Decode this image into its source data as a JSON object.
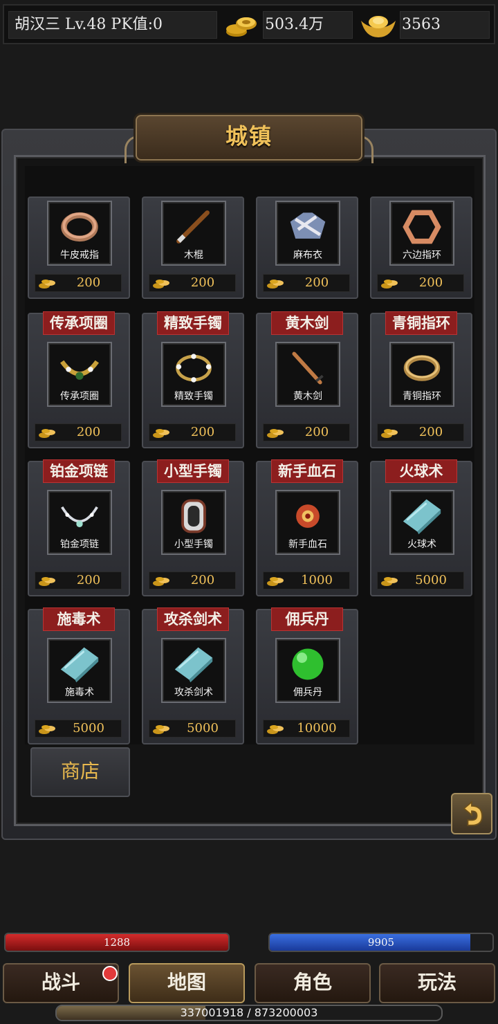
{
  "header": {
    "player": "胡汉三 Lv.48 PK值:0",
    "gold": "503.4万",
    "ingots": "3563",
    "gold_icon": "gold-coins-icon",
    "ingot_icon": "gold-ingot-icon"
  },
  "panel": {
    "title": "城镇",
    "shop_tab": "商店",
    "back_icon": "return-arrow-icon"
  },
  "items": [
    {
      "tag": "",
      "name": "牛皮戒指",
      "price": "200",
      "icon": "ring-icon"
    },
    {
      "tag": "",
      "name": "木棍",
      "price": "200",
      "icon": "stick-icon"
    },
    {
      "tag": "",
      "name": "麻布衣",
      "price": "200",
      "icon": "cloth-armor-icon"
    },
    {
      "tag": "",
      "name": "六边指环",
      "price": "200",
      "icon": "hex-ring-icon"
    },
    {
      "tag": "传承项圈",
      "name": "传承项圈",
      "price": "200",
      "icon": "necklace-icon"
    },
    {
      "tag": "精致手镯",
      "name": "精致手镯",
      "price": "200",
      "icon": "bracelet-icon"
    },
    {
      "tag": "黄木剑",
      "name": "黄木剑",
      "price": "200",
      "icon": "wooden-sword-icon"
    },
    {
      "tag": "青铜指环",
      "name": "青铜指环",
      "price": "200",
      "icon": "bronze-ring-icon"
    },
    {
      "tag": "铂金项链",
      "name": "铂金项链",
      "price": "200",
      "icon": "platinum-necklace-icon"
    },
    {
      "tag": "小型手镯",
      "name": "小型手镯",
      "price": "200",
      "icon": "small-bracelet-icon"
    },
    {
      "tag": "新手血石",
      "name": "新手血石",
      "price": "1000",
      "icon": "blood-stone-icon"
    },
    {
      "tag": "火球术",
      "name": "火球术",
      "price": "5000",
      "icon": "skill-book-icon"
    },
    {
      "tag": "施毒术",
      "name": "施毒术",
      "price": "5000",
      "icon": "skill-book-icon"
    },
    {
      "tag": "攻杀剑术",
      "name": "攻杀剑术",
      "price": "5000",
      "icon": "skill-book-icon"
    },
    {
      "tag": "佣兵丹",
      "name": "佣兵丹",
      "price": "10000",
      "icon": "green-pill-icon"
    }
  ],
  "status": {
    "hp": "1288",
    "mp": "9905",
    "hp_fill": 1.0,
    "mp_fill": 0.9,
    "exp_text": "337001918 / 873200003",
    "exp_fill": 0.386
  },
  "nav": {
    "battle": "战斗",
    "map": "地图",
    "character": "角色",
    "gameplay": "玩法",
    "active": "map"
  },
  "colors": {
    "gold_text": "#f0c15a",
    "tag_red": "#8c1e1e",
    "hp_red": "#d32b2b",
    "mp_blue": "#3a6fe0",
    "notify_dot": "#e23a3a"
  }
}
